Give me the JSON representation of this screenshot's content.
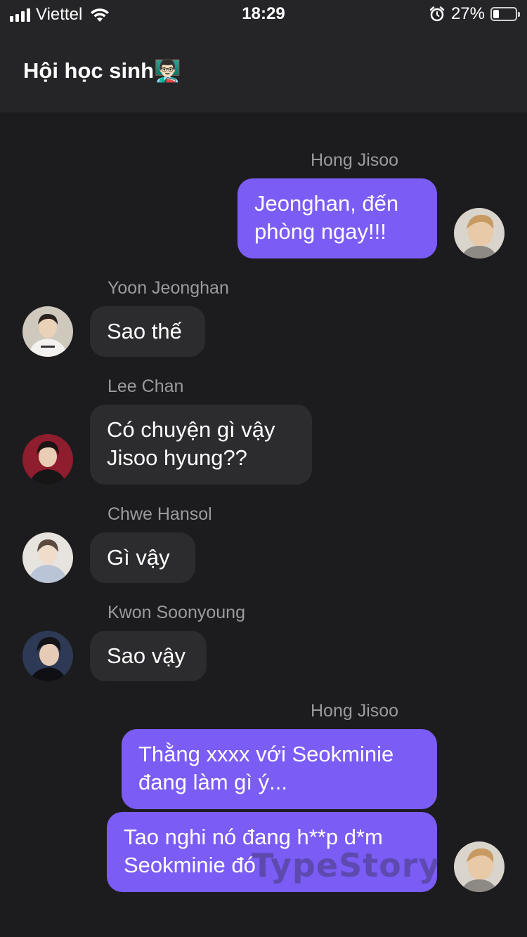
{
  "status_bar": {
    "carrier": "Viettel",
    "time": "18:29",
    "battery_percent_text": "27%",
    "battery_level": 0.27,
    "icons": [
      "signal-icon",
      "wifi-icon",
      "alarm-icon",
      "battery-icon"
    ]
  },
  "header": {
    "title": "Hội học sinh👨🏻‍🏫"
  },
  "messages": [
    {
      "sender": "Hong Jisoo",
      "text": "Jeonghan, đến phòng ngay!!!",
      "side": "out"
    },
    {
      "sender": "Yoon Jeonghan",
      "text": "Sao thế",
      "side": "in"
    },
    {
      "sender": "Lee Chan",
      "text": "Có chuyện gì vậy Jisoo hyung??",
      "side": "in"
    },
    {
      "sender": "Chwe Hansol",
      "text": "Gì vậy",
      "side": "in"
    },
    {
      "sender": "Kwon Soonyoung",
      "text": "Sao vậy",
      "side": "in"
    },
    {
      "sender": "Hong Jisoo",
      "text": "Thằng xxxx với Seokminie đang làm gì ý...",
      "side": "out"
    },
    {
      "sender": "",
      "text": "Tao nghi nó đang h**p d*m Seokminie đó",
      "side": "out"
    }
  ],
  "watermark": "TypeStory",
  "colors": {
    "background": "#1c1c1e",
    "header": "#252527",
    "outgoing_bubble": "#7b5cf5",
    "incoming_bubble": "#2c2c2e",
    "sender_name": "#9a9a9f"
  }
}
